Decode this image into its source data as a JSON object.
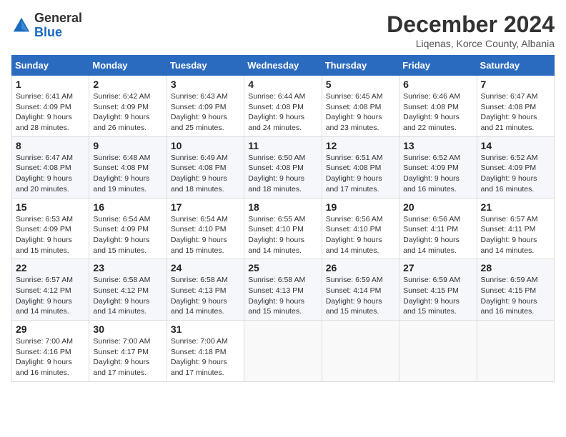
{
  "logo": {
    "general": "General",
    "blue": "Blue"
  },
  "header": {
    "month": "December 2024",
    "location": "Liqenas, Korce County, Albania"
  },
  "weekdays": [
    "Sunday",
    "Monday",
    "Tuesday",
    "Wednesday",
    "Thursday",
    "Friday",
    "Saturday"
  ],
  "weeks": [
    [
      {
        "day": 1,
        "sunrise": "6:41 AM",
        "sunset": "4:09 PM",
        "daylight": "9 hours and 28 minutes"
      },
      {
        "day": 2,
        "sunrise": "6:42 AM",
        "sunset": "4:09 PM",
        "daylight": "9 hours and 26 minutes"
      },
      {
        "day": 3,
        "sunrise": "6:43 AM",
        "sunset": "4:09 PM",
        "daylight": "9 hours and 25 minutes"
      },
      {
        "day": 4,
        "sunrise": "6:44 AM",
        "sunset": "4:08 PM",
        "daylight": "9 hours and 24 minutes"
      },
      {
        "day": 5,
        "sunrise": "6:45 AM",
        "sunset": "4:08 PM",
        "daylight": "9 hours and 23 minutes"
      },
      {
        "day": 6,
        "sunrise": "6:46 AM",
        "sunset": "4:08 PM",
        "daylight": "9 hours and 22 minutes"
      },
      {
        "day": 7,
        "sunrise": "6:47 AM",
        "sunset": "4:08 PM",
        "daylight": "9 hours and 21 minutes"
      }
    ],
    [
      {
        "day": 8,
        "sunrise": "6:47 AM",
        "sunset": "4:08 PM",
        "daylight": "9 hours and 20 minutes"
      },
      {
        "day": 9,
        "sunrise": "6:48 AM",
        "sunset": "4:08 PM",
        "daylight": "9 hours and 19 minutes"
      },
      {
        "day": 10,
        "sunrise": "6:49 AM",
        "sunset": "4:08 PM",
        "daylight": "9 hours and 18 minutes"
      },
      {
        "day": 11,
        "sunrise": "6:50 AM",
        "sunset": "4:08 PM",
        "daylight": "9 hours and 18 minutes"
      },
      {
        "day": 12,
        "sunrise": "6:51 AM",
        "sunset": "4:08 PM",
        "daylight": "9 hours and 17 minutes"
      },
      {
        "day": 13,
        "sunrise": "6:52 AM",
        "sunset": "4:09 PM",
        "daylight": "9 hours and 16 minutes"
      },
      {
        "day": 14,
        "sunrise": "6:52 AM",
        "sunset": "4:09 PM",
        "daylight": "9 hours and 16 minutes"
      }
    ],
    [
      {
        "day": 15,
        "sunrise": "6:53 AM",
        "sunset": "4:09 PM",
        "daylight": "9 hours and 15 minutes"
      },
      {
        "day": 16,
        "sunrise": "6:54 AM",
        "sunset": "4:09 PM",
        "daylight": "9 hours and 15 minutes"
      },
      {
        "day": 17,
        "sunrise": "6:54 AM",
        "sunset": "4:10 PM",
        "daylight": "9 hours and 15 minutes"
      },
      {
        "day": 18,
        "sunrise": "6:55 AM",
        "sunset": "4:10 PM",
        "daylight": "9 hours and 14 minutes"
      },
      {
        "day": 19,
        "sunrise": "6:56 AM",
        "sunset": "4:10 PM",
        "daylight": "9 hours and 14 minutes"
      },
      {
        "day": 20,
        "sunrise": "6:56 AM",
        "sunset": "4:11 PM",
        "daylight": "9 hours and 14 minutes"
      },
      {
        "day": 21,
        "sunrise": "6:57 AM",
        "sunset": "4:11 PM",
        "daylight": "9 hours and 14 minutes"
      }
    ],
    [
      {
        "day": 22,
        "sunrise": "6:57 AM",
        "sunset": "4:12 PM",
        "daylight": "9 hours and 14 minutes"
      },
      {
        "day": 23,
        "sunrise": "6:58 AM",
        "sunset": "4:12 PM",
        "daylight": "9 hours and 14 minutes"
      },
      {
        "day": 24,
        "sunrise": "6:58 AM",
        "sunset": "4:13 PM",
        "daylight": "9 hours and 14 minutes"
      },
      {
        "day": 25,
        "sunrise": "6:58 AM",
        "sunset": "4:13 PM",
        "daylight": "9 hours and 15 minutes"
      },
      {
        "day": 26,
        "sunrise": "6:59 AM",
        "sunset": "4:14 PM",
        "daylight": "9 hours and 15 minutes"
      },
      {
        "day": 27,
        "sunrise": "6:59 AM",
        "sunset": "4:15 PM",
        "daylight": "9 hours and 15 minutes"
      },
      {
        "day": 28,
        "sunrise": "6:59 AM",
        "sunset": "4:15 PM",
        "daylight": "9 hours and 16 minutes"
      }
    ],
    [
      {
        "day": 29,
        "sunrise": "7:00 AM",
        "sunset": "4:16 PM",
        "daylight": "9 hours and 16 minutes"
      },
      {
        "day": 30,
        "sunrise": "7:00 AM",
        "sunset": "4:17 PM",
        "daylight": "9 hours and 17 minutes"
      },
      {
        "day": 31,
        "sunrise": "7:00 AM",
        "sunset": "4:18 PM",
        "daylight": "9 hours and 17 minutes"
      },
      null,
      null,
      null,
      null
    ]
  ],
  "labels": {
    "sunrise": "Sunrise:",
    "sunset": "Sunset:",
    "daylight": "Daylight:"
  }
}
